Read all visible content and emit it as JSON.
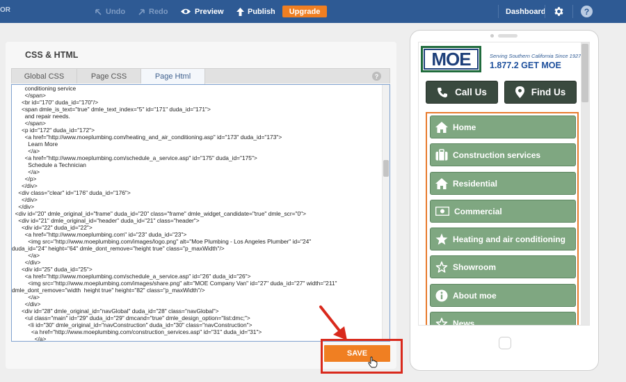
{
  "topbar": {
    "brand_fragment": "OR",
    "undo": "Undo",
    "redo": "Redo",
    "preview": "Preview",
    "publish": "Publish",
    "upgrade": "Upgrade",
    "dashboard": "Dashboard",
    "help": "?"
  },
  "panel": {
    "title": "CSS & HTML",
    "tabs": [
      "Global CSS",
      "Page CSS",
      "Page Html"
    ],
    "active_tab": "Page Html",
    "help": "?",
    "save_label": "SAVE"
  },
  "code_lines": [
    "        conditioning service",
    "        </span>",
    "      <br id=\"170\" duda_id=\"170\"/>",
    "      <span dmle_is_text=\"true\" dmle_text_index=\"5\" id=\"171\" duda_id=\"171\">",
    "        and repair needs.",
    "        </span>",
    "      <p id=\"172\" duda_id=\"172\">",
    "        <a href=\"http://www.moeplumbing.com/heating_and_air_conditioning.asp\" id=\"173\" duda_id=\"173\">",
    "          Learn More",
    "          </a>",
    "        <a href=\"http://www.moeplumbing.com/schedule_a_service.asp\" id=\"175\" duda_id=\"175\">",
    "          Schedule a Technician",
    "          </a>",
    "        </p>",
    "      </div>",
    "    <div class=\"clear\" id=\"176\" duda_id=\"176\">",
    "      </div>",
    "    </div>",
    "  <div id=\"20\" dmle_original_id=\"frame\" duda_id=\"20\" class=\"frame\" dmle_widget_candidate=\"true\" dmle_scr=\"0\">",
    "    <div id=\"21\" dmle_original_id=\"header\" duda_id=\"21\" class=\"header\">",
    "      <div id=\"22\" duda_id=\"22\">",
    "        <a href=\"http://www.moeplumbing.com\" id=\"23\" duda_id=\"23\">",
    "          <img src=\"http://www.moeplumbing.com/images/logo.png\" alt=\"Moe Plumbing - Los Angeles Plumber\" id=\"24\"",
    "duda_id=\"24\" height=\"64\" dmle_dont_remove=\"height true\" class=\"p_maxWidth\"/>",
    "          </a>",
    "        </div>",
    "      <div id=\"25\" duda_id=\"25\">",
    "        <a href=\"http://www.moeplumbing.com/schedule_a_service.asp\" id=\"26\" duda_id=\"26\">",
    "          <img src=\"http://www.moeplumbing.com/images/share.png\" alt=\"MOE Company Van\" id=\"27\" duda_id=\"27\" width=\"211\"",
    "dmle_dont_remove=\"width  height true\" height=\"82\" class=\"p_maxWidth\"/>",
    "          </a>",
    "        </div>",
    "      <div id=\"28\" dmle_original_id=\"navGlobal\" duda_id=\"28\" class=\"navGlobal\">",
    "        <ul class=\"main\" id=\"29\" duda_id=\"29\" dmcand=\"true\" dmle_design_option=\"list:dmc;\">",
    "          <li id=\"30\" dmle_original_id=\"navConstruction\" duda_id=\"30\" class=\"navConstruction\">",
    "            <a href=\"http://www.moeplumbing.com/construction_services.asp\" id=\"31\" duda_id=\"31\">",
    "              </a>"
  ],
  "preview": {
    "logo_text": "MOE",
    "tagline": "Serving Southern California Since 1927",
    "phone": "1.877.2 GET MOE",
    "call_us": "Call Us",
    "find_us": "Find Us",
    "nav": [
      {
        "label": "Home",
        "icon": "home-icon"
      },
      {
        "label": "Construction services",
        "icon": "briefcase-icon"
      },
      {
        "label": "Residential",
        "icon": "home-icon"
      },
      {
        "label": "Commercial",
        "icon": "money-icon"
      },
      {
        "label": "Heating and air conditioning",
        "icon": "star-filled-icon"
      },
      {
        "label": "Showroom",
        "icon": "star-outline-icon"
      },
      {
        "label": "About moe",
        "icon": "info-icon"
      },
      {
        "label": "News",
        "icon": "star-outline-icon"
      }
    ]
  },
  "colors": {
    "topbar": "#2e5a94",
    "accent_orange": "#f07f22",
    "highlight_red": "#d9291c",
    "nav_green": "#7fa781"
  }
}
